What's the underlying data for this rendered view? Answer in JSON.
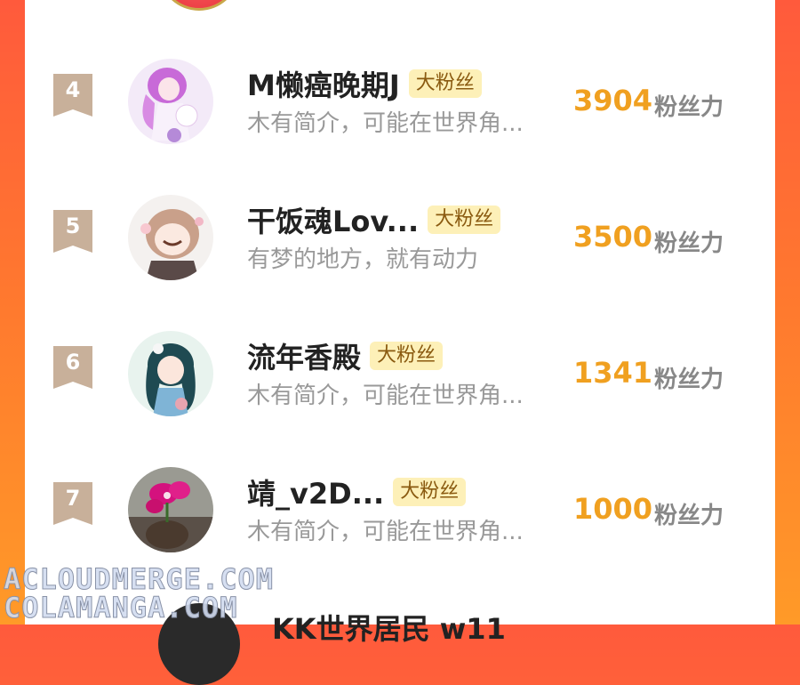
{
  "colors": {
    "accent": "#f0a020",
    "badge_bg": "#fdf0b8",
    "rank_ribbon": "#c8b09a",
    "background_gradient": [
      "#ff5a3c",
      "#ff9a28"
    ]
  },
  "fans": [
    {
      "rank": "4",
      "name": "M懒癌晚期J",
      "badge": "大粉丝",
      "bio": "木有简介，可能在世界角...",
      "score": "3904",
      "score_label": "粉丝力",
      "avatar_icon": "anime-girl-purple-avatar"
    },
    {
      "rank": "5",
      "name": "干饭魂Lov...",
      "badge": "大粉丝",
      "bio": "有梦的地方，就有动力",
      "score": "3500",
      "score_label": "粉丝力",
      "avatar_icon": "chibi-girl-avatar"
    },
    {
      "rank": "6",
      "name": "流年香殿",
      "badge": "大粉丝",
      "bio": "木有简介，可能在世界角...",
      "score": "1341",
      "score_label": "粉丝力",
      "avatar_icon": "anime-girl-teal-avatar"
    },
    {
      "rank": "7",
      "name": "靖_v2D...",
      "badge": "大粉丝",
      "bio": "木有简介，可能在世界角...",
      "score": "1000",
      "score_label": "粉丝力",
      "avatar_icon": "orchid-flower-avatar"
    }
  ],
  "next_partial": {
    "name": "KK世界居民 w11"
  },
  "watermark": {
    "line1": "ACLOUDMERGE.COM",
    "line2": "COLAMANGA.COM"
  }
}
